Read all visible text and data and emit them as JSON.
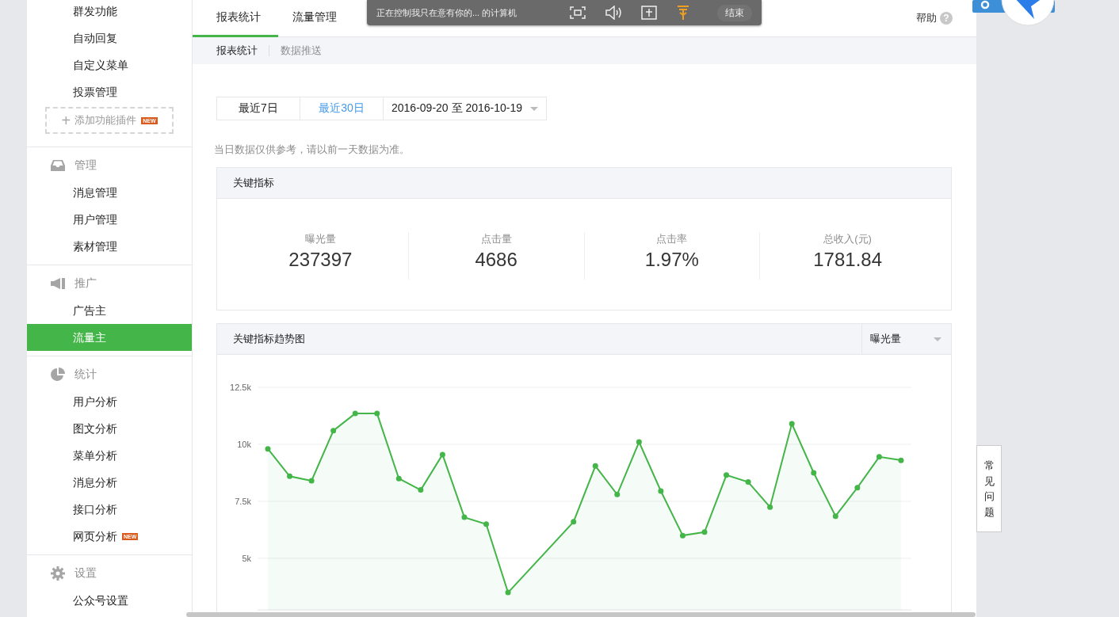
{
  "sidebar": {
    "top_items": [
      {
        "label": "群发功能",
        "selected": false
      },
      {
        "label": "自动回复",
        "selected": false
      },
      {
        "label": "自定义菜单",
        "selected": false
      },
      {
        "label": "投票管理",
        "selected": false
      }
    ],
    "add_plugin": {
      "icon": "+",
      "label": "添加功能插件",
      "badge": "NEW"
    },
    "sections": [
      {
        "title": "管理",
        "items": [
          {
            "label": "消息管理",
            "selected": false
          },
          {
            "label": "用户管理",
            "selected": false
          },
          {
            "label": "素材管理",
            "selected": false
          }
        ]
      },
      {
        "title": "推广",
        "items": [
          {
            "label": "广告主",
            "selected": false
          },
          {
            "label": "流量主",
            "selected": true
          }
        ]
      },
      {
        "title": "统计",
        "items": [
          {
            "label": "用户分析",
            "selected": false
          },
          {
            "label": "图文分析",
            "selected": false
          },
          {
            "label": "菜单分析",
            "selected": false
          },
          {
            "label": "消息分析",
            "selected": false
          },
          {
            "label": "接口分析",
            "selected": false
          },
          {
            "label": "网页分析",
            "selected": false,
            "badge": "NEW"
          }
        ]
      },
      {
        "title": "设置",
        "items": [
          {
            "label": "公众号设置",
            "selected": false
          }
        ]
      }
    ]
  },
  "tabs": [
    {
      "label": "报表统计",
      "selected": true
    },
    {
      "label": "流量管理",
      "selected": false
    }
  ],
  "help": {
    "label": "帮助",
    "icon": "?"
  },
  "subtabs": [
    {
      "label": "报表统计",
      "selected": true
    },
    {
      "label": "数据推送",
      "selected": false
    }
  ],
  "remote_toolbar": {
    "message": "正在控制我只在意有你的... 的计算机",
    "end_button": "结束"
  },
  "date_filter": {
    "presets": [
      {
        "label": "最近7日",
        "selected": false
      },
      {
        "label": "最近30日",
        "selected": true
      }
    ],
    "range": "2016-09-20 至 2016-10-19"
  },
  "note": "当日数据仅供参考，请以前一天数据为准。",
  "key_metrics": {
    "title": "关键指标",
    "items": [
      {
        "label": "曝光量",
        "value": "237397"
      },
      {
        "label": "点击量",
        "value": "4686"
      },
      {
        "label": "点击率",
        "value": "1.97%"
      },
      {
        "label": "总收入(元)",
        "value": "1781.84"
      }
    ]
  },
  "trend": {
    "title": "关键指标趋势图",
    "chart_data": {
      "type": "area",
      "ylim": [
        2740,
        12500
      ],
      "grid": true,
      "yticks": [
        {
          "value": 5000,
          "label": "5k"
        },
        {
          "value": 7500,
          "label": "7.5k"
        },
        {
          "value": 10000,
          "label": "10k"
        },
        {
          "value": 12500,
          "label": "12.5k"
        }
      ],
      "series": [
        {
          "name": "曝光量",
          "color": "#44b549",
          "values": [
            9800,
            8600,
            8400,
            10600,
            11350,
            11350,
            8500,
            8000,
            9550,
            6800,
            6500,
            3500,
            null,
            null,
            6600,
            9050,
            7800,
            10100,
            7950,
            6000,
            6150,
            8650,
            8350,
            7250,
            10900,
            8750,
            6850,
            8100,
            9450,
            9300
          ]
        }
      ]
    }
  },
  "faq_tab": "常见问题"
}
